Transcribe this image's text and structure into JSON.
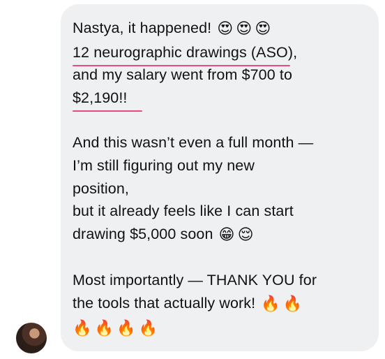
{
  "message": {
    "lines": [
      "Nastya, it happened!",
      "12 neurographic drawings (ASO),",
      "and my salary went from $700 to",
      "$2,190!!",
      "",
      "And this wasn’t even a full month —",
      "I’m still figuring out my new",
      "position,",
      "but it already feels like I can start",
      "drawing $5,000 soon",
      "",
      "Most importantly — THANK YOU for",
      "the tools that actually work!"
    ],
    "emojis": {
      "heart_eyes": "😍",
      "grin": "😁",
      "relieved": "😌",
      "fire": "🔥"
    }
  },
  "colors": {
    "bubble_background": "#eef0f2",
    "underline": "#e44b82",
    "text": "#111111"
  },
  "icons": {
    "avatar": "user-avatar-photo"
  }
}
